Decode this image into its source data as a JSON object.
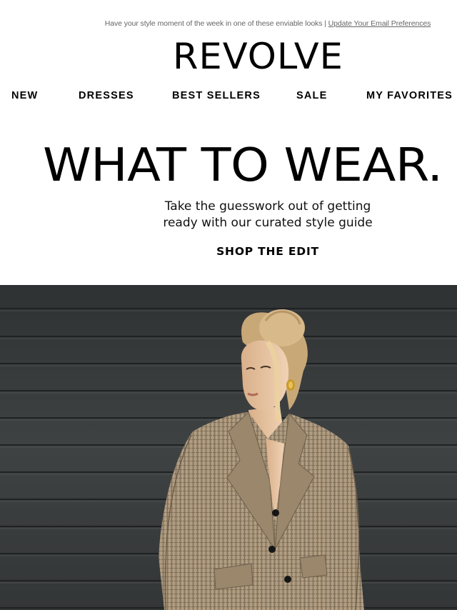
{
  "preheader": {
    "text": "Have your style moment of the week in one of these enviable looks | ",
    "link_label": "Update Your Email Preferences"
  },
  "brand": {
    "logo_text": "REVOLVE"
  },
  "nav": {
    "items": [
      {
        "label": "NEW"
      },
      {
        "label": "DRESSES"
      },
      {
        "label": "BEST SELLERS"
      },
      {
        "label": "SALE"
      },
      {
        "label": "MY FAVORITES"
      }
    ]
  },
  "hero": {
    "title": "WHAT TO WEAR.",
    "subtitle_line1": "Take the guesswork out of getting",
    "subtitle_line2": "ready with our curated style guide",
    "cta_label": "SHOP THE EDIT"
  },
  "image": {
    "colors": {
      "wall": "#3c3f40",
      "blazer": "#a8957a",
      "skin": "#e8c9a8",
      "hair": "#d8b98a"
    }
  }
}
